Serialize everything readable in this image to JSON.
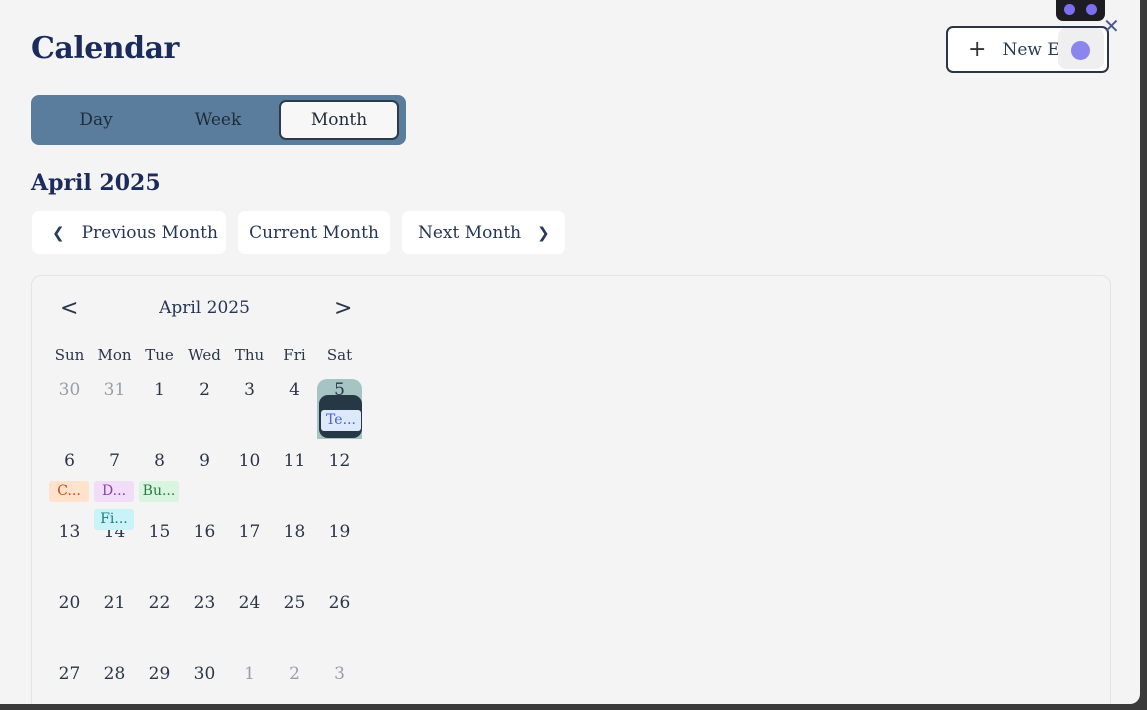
{
  "modal": {
    "title": "Calendar",
    "new_event_label": "New Ev",
    "new_event_icon": "plus-icon",
    "close_icon": "close-icon"
  },
  "view_switch": {
    "options": [
      "Day",
      "Week",
      "Month"
    ],
    "selected": "Month"
  },
  "month_heading": "April 2025",
  "nav": {
    "prev_label": "Previous Month",
    "current_label": "Current Month",
    "next_label": "Next Month"
  },
  "mini_calendar": {
    "title": "April 2025",
    "weekdays": [
      "Sun",
      "Mon",
      "Tue",
      "Wed",
      "Thu",
      "Fri",
      "Sat"
    ],
    "weeks": [
      [
        "30",
        "31",
        "1",
        "2",
        "3",
        "4",
        "5"
      ],
      [
        "6",
        "7",
        "8",
        "9",
        "10",
        "11",
        "12"
      ],
      [
        "13",
        "14",
        "15",
        "16",
        "17",
        "18",
        "19"
      ],
      [
        "20",
        "21",
        "22",
        "23",
        "24",
        "25",
        "26"
      ],
      [
        "27",
        "28",
        "29",
        "30",
        "1",
        "2",
        "3"
      ]
    ],
    "selected_day": "5",
    "events": [
      {
        "label": "Te...",
        "day": "5",
        "bg": "#dde8fb",
        "fg": "#4a63c9"
      },
      {
        "label": "C...",
        "day": "6",
        "bg": "#ffe2cc",
        "fg": "#c24a12"
      },
      {
        "label": "D...",
        "day": "7",
        "bg": "#f1ddf8",
        "fg": "#8a3fb0"
      },
      {
        "label": "Bu...",
        "day": "8",
        "bg": "#d9f5e0",
        "fg": "#2d7a45"
      },
      {
        "label": "Fi...",
        "day": "7",
        "bg": "#c9f3f7",
        "fg": "#1d7a85"
      }
    ]
  },
  "colors": {
    "accent": "#5b7d9d",
    "title": "#1a2b5c",
    "selected_day": "#a7c4c4",
    "selected_event": "#263845",
    "assistant": "#7b6ff0"
  }
}
